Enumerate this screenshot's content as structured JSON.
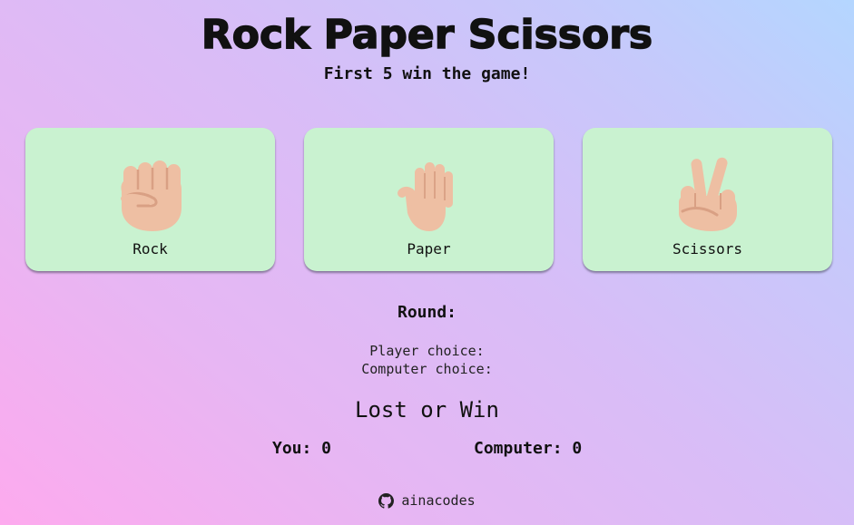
{
  "header": {
    "title": "Rock Paper Scissors",
    "subtitle": "First 5 win the game!"
  },
  "choices": [
    {
      "label": "Rock",
      "icon": "fist-icon"
    },
    {
      "label": "Paper",
      "icon": "open-hand-icon"
    },
    {
      "label": "Scissors",
      "icon": "victory-hand-icon"
    }
  ],
  "status": {
    "round_label": "Round:",
    "player_choice_label": "Player choice:",
    "computer_choice_label": "Computer choice:",
    "result_text": "Lost or Win"
  },
  "score": {
    "you_text": "You: 0",
    "computer_text": "Computer: 0"
  },
  "footer": {
    "link_text": "ainacodes",
    "icon": "github-icon"
  },
  "colors": {
    "card_bg": "#c9f2d0",
    "skin": "#eebfa3",
    "skin_shade": "#d9a084"
  }
}
